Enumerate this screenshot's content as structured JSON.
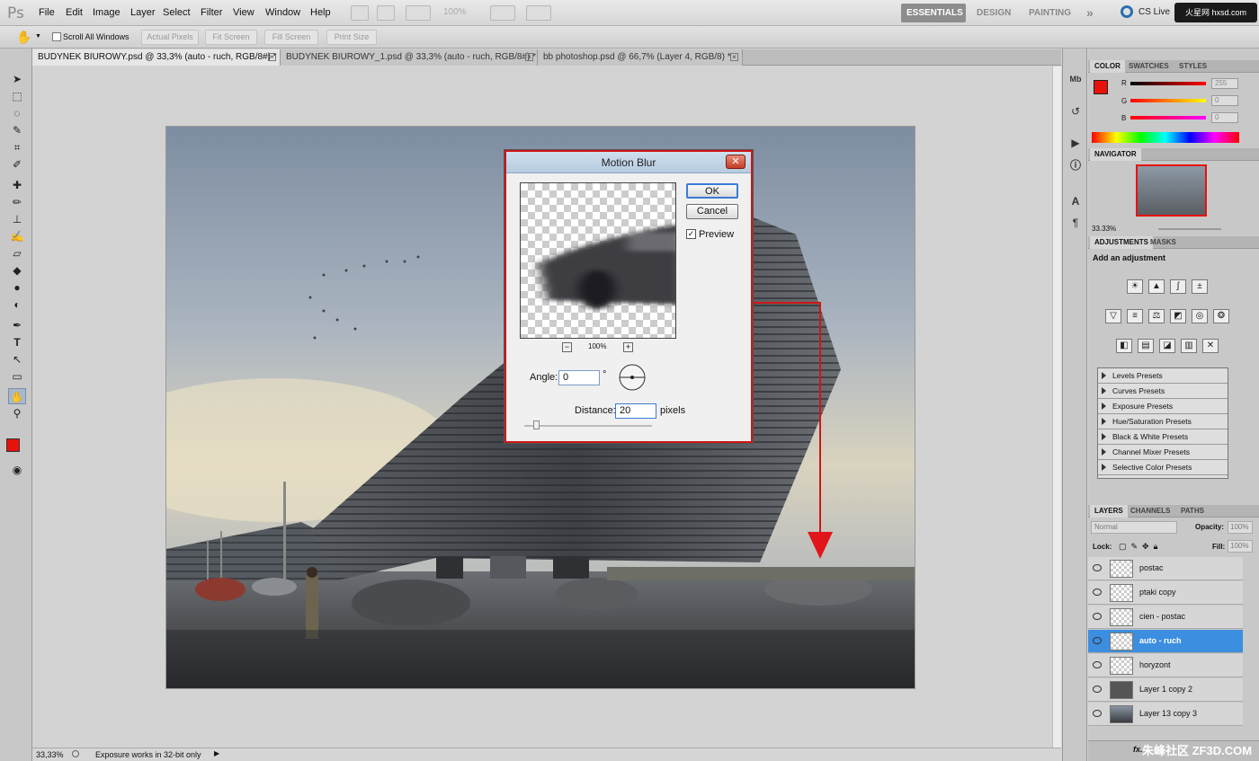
{
  "app": {
    "logo": "Ps"
  },
  "menu": [
    "File",
    "Edit",
    "Image",
    "Layer",
    "Select",
    "Filter",
    "View",
    "Window",
    "Help"
  ],
  "menubar": {
    "zoom": "100%",
    "workspaces": [
      "ESSENTIALS",
      "DESIGN",
      "PAINTING"
    ],
    "more": "»",
    "cslive": "CS Live",
    "watermark": "火星网 hxsd.com"
  },
  "options": {
    "scroll_all": "Scroll All Windows",
    "actual_pixels": "Actual Pixels",
    "fit_screen": "Fit Screen",
    "fill_screen": "Fill Screen",
    "print_size": "Print Size"
  },
  "tabs": [
    {
      "label": "BUDYNEK BIUROWY.psd @ 33,3% (auto - ruch, RGB/8#) *"
    },
    {
      "label": "BUDYNEK BIUROWY_1.psd @ 33,3% (auto - ruch, RGB/8#) *"
    },
    {
      "label": "bb photoshop.psd @ 66,7% (Layer 4, RGB/8) *"
    }
  ],
  "status": {
    "zoom": "33,33%",
    "message": "Exposure works in 32-bit only"
  },
  "dialog": {
    "title": "Motion Blur",
    "close": "✕",
    "ok": "OK",
    "cancel": "Cancel",
    "preview": "Preview",
    "preview_zoom": "100%",
    "zoom_minus": "−",
    "zoom_plus": "+",
    "angle_label": "Angle:",
    "angle_value": "0",
    "degree": "°",
    "distance_label": "Distance:",
    "distance_value": "20",
    "unit": "pixels"
  },
  "color_panel": {
    "tabs": [
      "COLOR",
      "SWATCHES",
      "STYLES"
    ],
    "r_label": "R",
    "g_label": "G",
    "b_label": "B",
    "r": "255",
    "g": "0",
    "b": "0",
    "fg": "#e8120c"
  },
  "navigator": {
    "tab": "NAVIGATOR",
    "zoom": "33.33%"
  },
  "adjustments": {
    "tabs": [
      "ADJUSTMENTS",
      "MASKS"
    ],
    "heading": "Add an adjustment",
    "presets": [
      "Levels Presets",
      "Curves Presets",
      "Exposure Presets",
      "Hue/Saturation Presets",
      "Black & White Presets",
      "Channel Mixer Presets",
      "Selective Color Presets"
    ]
  },
  "layers_panel": {
    "tabs": [
      "LAYERS",
      "CHANNELS",
      "PATHS"
    ],
    "blend_mode": "Normal",
    "opacity_label": "Opacity:",
    "opacity": "100%",
    "lock_label": "Lock:",
    "fill_label": "Fill:",
    "fill": "100%",
    "layers": [
      {
        "name": "postac"
      },
      {
        "name": "ptaki copy"
      },
      {
        "name": "cien - postac"
      },
      {
        "name": "auto - ruch",
        "selected": true
      },
      {
        "name": "horyzont"
      },
      {
        "name": "Layer 1 copy 2"
      },
      {
        "name": "Layer 13 copy 3"
      }
    ],
    "footer_watermark": "朱峰社区 ZF3D.COM"
  }
}
